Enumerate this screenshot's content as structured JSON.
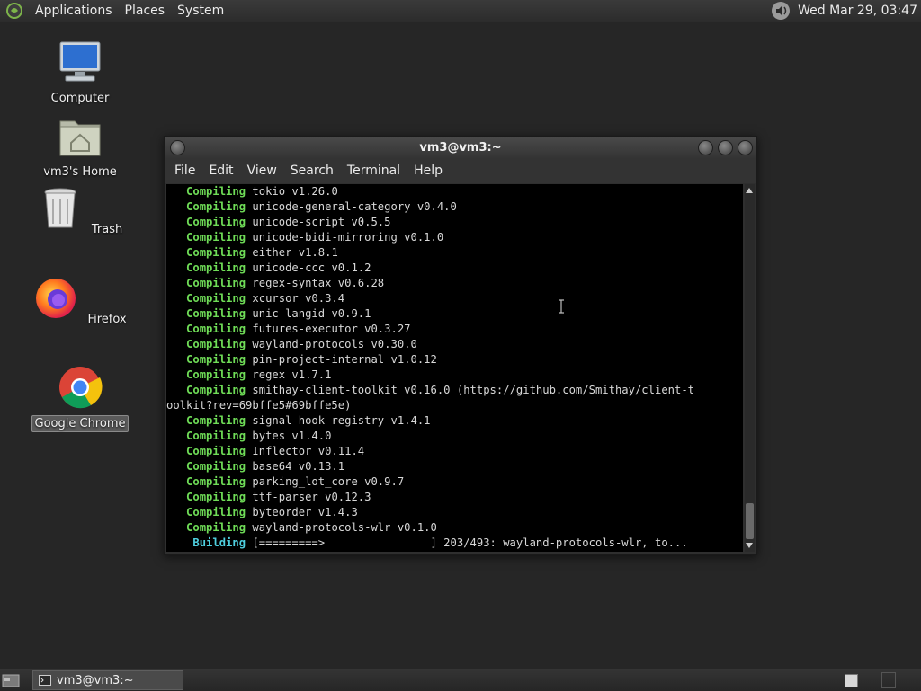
{
  "top_panel": {
    "menus": [
      "Applications",
      "Places",
      "System"
    ],
    "icons": {
      "logo": "distro-logo-icon",
      "volume": "volume-icon"
    },
    "clock": "Wed Mar 29, 03:47"
  },
  "desktop": {
    "icons": [
      {
        "label": "Computer",
        "icon": "computer-icon"
      },
      {
        "label": "vm3's Home",
        "icon": "home-folder-icon"
      },
      {
        "label": "Trash",
        "icon": "trash-icon"
      },
      {
        "label": "Firefox",
        "icon": "firefox-icon"
      },
      {
        "label": "Google Chrome",
        "icon": "chrome-icon",
        "selected": true
      }
    ]
  },
  "terminal": {
    "title": "vm3@vm3:~",
    "menu": [
      "File",
      "Edit",
      "View",
      "Search",
      "Terminal",
      "Help"
    ],
    "lines": [
      {
        "kw": "Compiling",
        "text": " tokio v1.26.0"
      },
      {
        "kw": "Compiling",
        "text": " unicode-general-category v0.4.0"
      },
      {
        "kw": "Compiling",
        "text": " unicode-script v0.5.5"
      },
      {
        "kw": "Compiling",
        "text": " unicode-bidi-mirroring v0.1.0"
      },
      {
        "kw": "Compiling",
        "text": " either v1.8.1"
      },
      {
        "kw": "Compiling",
        "text": " unicode-ccc v0.1.2"
      },
      {
        "kw": "Compiling",
        "text": " regex-syntax v0.6.28"
      },
      {
        "kw": "Compiling",
        "text": " xcursor v0.3.4"
      },
      {
        "kw": "Compiling",
        "text": " unic-langid v0.9.1"
      },
      {
        "kw": "Compiling",
        "text": " futures-executor v0.3.27"
      },
      {
        "kw": "Compiling",
        "text": " wayland-protocols v0.30.0"
      },
      {
        "kw": "Compiling",
        "text": " pin-project-internal v1.0.12"
      },
      {
        "kw": "Compiling",
        "text": " regex v1.7.1"
      },
      {
        "kw": "Compiling",
        "text": " smithay-client-toolkit v0.16.0 (https://github.com/Smithay/client-t"
      },
      {
        "kw": "",
        "text": "oolkit?rev=69bffe5#69bffe5e)"
      },
      {
        "kw": "Compiling",
        "text": " signal-hook-registry v1.4.1"
      },
      {
        "kw": "Compiling",
        "text": " bytes v1.4.0"
      },
      {
        "kw": "Compiling",
        "text": " Inflector v0.11.4"
      },
      {
        "kw": "Compiling",
        "text": " base64 v0.13.1"
      },
      {
        "kw": "Compiling",
        "text": " parking_lot_core v0.9.7"
      },
      {
        "kw": "Compiling",
        "text": " ttf-parser v0.12.3"
      },
      {
        "kw": "Compiling",
        "text": " byteorder v1.4.3"
      },
      {
        "kw": "Compiling",
        "text": " wayland-protocols-wlr v0.1.0"
      },
      {
        "kw": "Building",
        "text": " [=========>                ] 203/493: wayland-protocols-wlr, to..."
      }
    ]
  },
  "taskbar": {
    "window_button": "vm3@vm3:~",
    "icons": {
      "show_desktop": "show-desktop-icon",
      "task": "terminal-icon"
    }
  },
  "colors": {
    "compiling": "#6fdc57",
    "building": "#4fd0e0",
    "terminal_bg": "#000000"
  }
}
